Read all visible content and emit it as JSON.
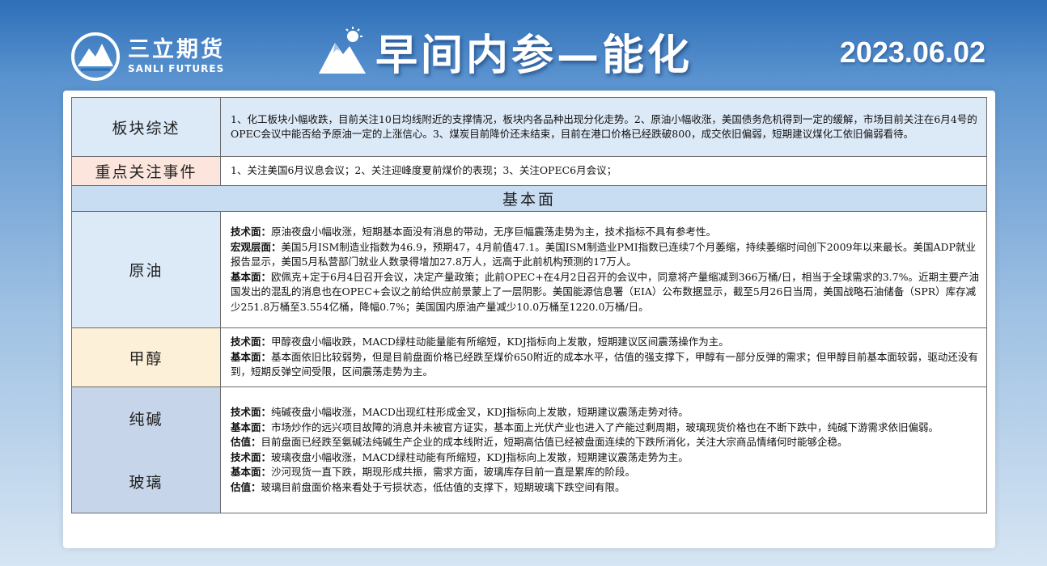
{
  "header": {
    "logo_cn": "三立期货",
    "logo_en": "SANLI FUTURES",
    "title": "早间内参—能化",
    "date": "2023.06.02"
  },
  "table": {
    "sector_summary": {
      "label": "板块综述",
      "text": "1、化工板块小幅收跌，目前关注10日均线附近的支撑情况，板块内各品种出现分化走势。2、原油小幅收涨，美国债务危机得到一定的缓解，市场目前关注在6月4号的OPEC会议中能否给予原油一定的上涨信心。3、煤炭目前降价还未结束，目前在港口价格已经跌破800，成交依旧偏弱，短期建议煤化工依旧偏弱看待。"
    },
    "key_events": {
      "label": "重点关注事件",
      "text": "1、关注美国6月议息会议；2、关注迎峰度夏前煤价的表现；3、关注OPEC6月会议；"
    },
    "fundamentals_header": "基本面",
    "crude": {
      "label": "原油",
      "lines": [
        {
          "k": "技术面：",
          "v": "原油夜盘小幅收涨，短期基本面没有消息的带动，无序巨幅震荡走势为主，技术指标不具有参考性。"
        },
        {
          "k": "宏观层面：",
          "v": "美国5月ISM制造业指数为46.9，预期47，4月前值47.1。美国ISM制造业PMI指数已连续7个月萎缩，持续萎缩时间创下2009年以来最长。美国ADP就业报告显示，美国5月私营部门就业人数录得增加27.8万人，远高于此前机构预测的17万人。"
        },
        {
          "k": "基本面：",
          "v": "欧佩克+定于6月4日召开会议，决定产量政策；此前OPEC+在4月2日召开的会议中，同意将产量缩减到366万桶/日，相当于全球需求的3.7%。近期主要产油国发出的混乱的消息也在OPEC+会议之前给供应前景蒙上了一层阴影。美国能源信息署（EIA）公布数据显示，截至5月26日当周，美国战略石油储备（SPR）库存减少251.8万桶至3.554亿桶，降幅0.7%；美国国内原油产量减少10.0万桶至1220.0万桶/日。"
        }
      ]
    },
    "methanol": {
      "label": "甲醇",
      "lines": [
        {
          "k": "技术面：",
          "v": "甲醇夜盘小幅收跌，MACD绿柱动能量能有所缩短，KDJ指标向上发散，短期建议区间震荡操作为主。"
        },
        {
          "k": "基本面：",
          "v": "基本面依旧比较弱势，但是目前盘面价格已经跌至煤价650附近的成本水平，估值的强支撑下，甲醇有一部分反弹的需求；但甲醇目前基本面较弱，驱动还没有到，短期反弹空间受限，区间震荡走势为主。"
        }
      ]
    },
    "soda_glass": {
      "label_soda": "纯碱",
      "label_glass": "玻璃",
      "lines": [
        {
          "k": "技术面：",
          "v": "纯碱夜盘小幅收涨，MACD出现红柱形成金叉，KDJ指标向上发散，短期建议震荡走势对待。"
        },
        {
          "k": "基本面：",
          "v": "市场炒作的远兴项目故障的消息并未被官方证实，基本面上光伏产业也进入了产能过剩周期，玻璃现货价格也在不断下跌中，纯碱下游需求依旧偏弱。"
        },
        {
          "k": "估值：",
          "v": "目前盘面已经跌至氨碱法纯碱生产企业的成本线附近，短期高估值已经被盘面连续的下跌所消化，关注大宗商品情绪何时能够企稳。"
        },
        {
          "k": "技术面：",
          "v": "玻璃夜盘小幅收涨，MACD绿柱动能有所缩短，KDJ指标向上发散，短期建议震荡走势为主。"
        },
        {
          "k": "基本面：",
          "v": "沙河现货一直下跌，期现形成共振，需求方面，玻璃库存目前一直是累库的阶段。"
        },
        {
          "k": "估值：",
          "v": "玻璃目前盘面价格来看处于亏损状态，低估值的支撑下，短期玻璃下跌空间有限。"
        }
      ]
    }
  }
}
